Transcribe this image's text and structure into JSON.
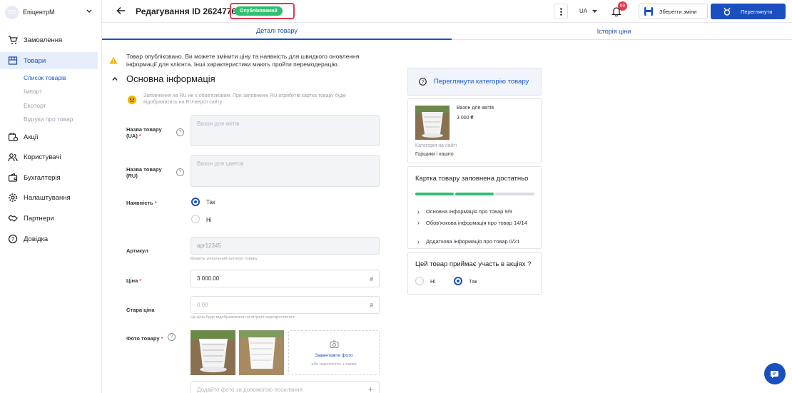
{
  "sidebar": {
    "company": "ЕпіцентрМ",
    "avatar_initials": "ЕП",
    "items": [
      {
        "label": "Замовлення",
        "icon": "cart-icon"
      },
      {
        "label": "Товари",
        "icon": "box-icon"
      },
      {
        "label": "Акції",
        "icon": "promo-icon"
      },
      {
        "label": "Користувачі",
        "icon": "users-icon"
      },
      {
        "label": "Бухгалтерія",
        "icon": "wallet-icon"
      },
      {
        "label": "Налаштування",
        "icon": "gear-icon"
      },
      {
        "label": "Партнери",
        "icon": "handshake-icon"
      },
      {
        "label": "Довідка",
        "icon": "help-icon"
      }
    ],
    "products_sub": [
      "Список товарів",
      "Імпорт",
      "Експорт",
      "Відгуки про товар"
    ]
  },
  "header": {
    "title": "Редагування ID 26247760",
    "status": "Опублікований",
    "lang": "UA",
    "notif_count": "99",
    "save_label": "Зберегти зміни",
    "view_label": "Переглянути"
  },
  "tabs": [
    "Деталі товару",
    "Історія ціни"
  ],
  "notice": "Товар опубліковано. Ви можете змінити ціну та наявність для швидкого оновлення інформації для клієнта. Інші характеристики мають пройти перемодерацію.",
  "section_title": "Основна інформація",
  "ru_note": "Заповнення на RU не є обов'язковим. При заповненні RU атрибутів картка товару буде відображатись на RU-версії сайту",
  "form": {
    "name_ua_label": "Назва товару (UA)",
    "name_ua_placeholder": "Вазон для квітів",
    "name_ru_label": "Назва товару (RU)",
    "name_ru_placeholder": "Вазон для цветов",
    "availability_label": "Наявність",
    "yes": "Так",
    "no": "Ні",
    "sku_label": "Артикул",
    "sku_value": "apr12345",
    "sku_hint": "Вкажіть унікальний артикул товару",
    "price_label": "Ціна",
    "price_value": "3 000.00",
    "currency": "₴",
    "old_price_label": "Стара ціна",
    "old_price_value": "0.00",
    "old_price_hint": "Ця ціна буде відображатися на вітрині перекресленою",
    "photo_label": "Фото товару",
    "upload_label": "Завантажте фото",
    "upload_sub": "або перетягніть з папки",
    "photo_url_placeholder": "Додайте фото за допомогою посилання"
  },
  "right": {
    "category_link": "Переглянути категорію товару",
    "product_name": "Вазон для квітів",
    "product_price": "3 000 ₴",
    "category_caption": "Категорія на сайті",
    "category_value": "Горщики і кашпо",
    "completeness_title": "Картка товару заповнена достатньо",
    "progress_segments": [
      1,
      1,
      0
    ],
    "checklist": [
      "Основна інформація про товар 9/9",
      "Обов'язкова інформація про товар 14/14",
      "Додаткова інформація про товар 0/21"
    ],
    "promo_question": "Цей товар приймає участь в акціях ?",
    "promo_no": "Ні",
    "promo_yes": "Так"
  },
  "colors": {
    "accent": "#1a4fbf",
    "success": "#2fbf71",
    "badge_border": "#e5384b"
  }
}
